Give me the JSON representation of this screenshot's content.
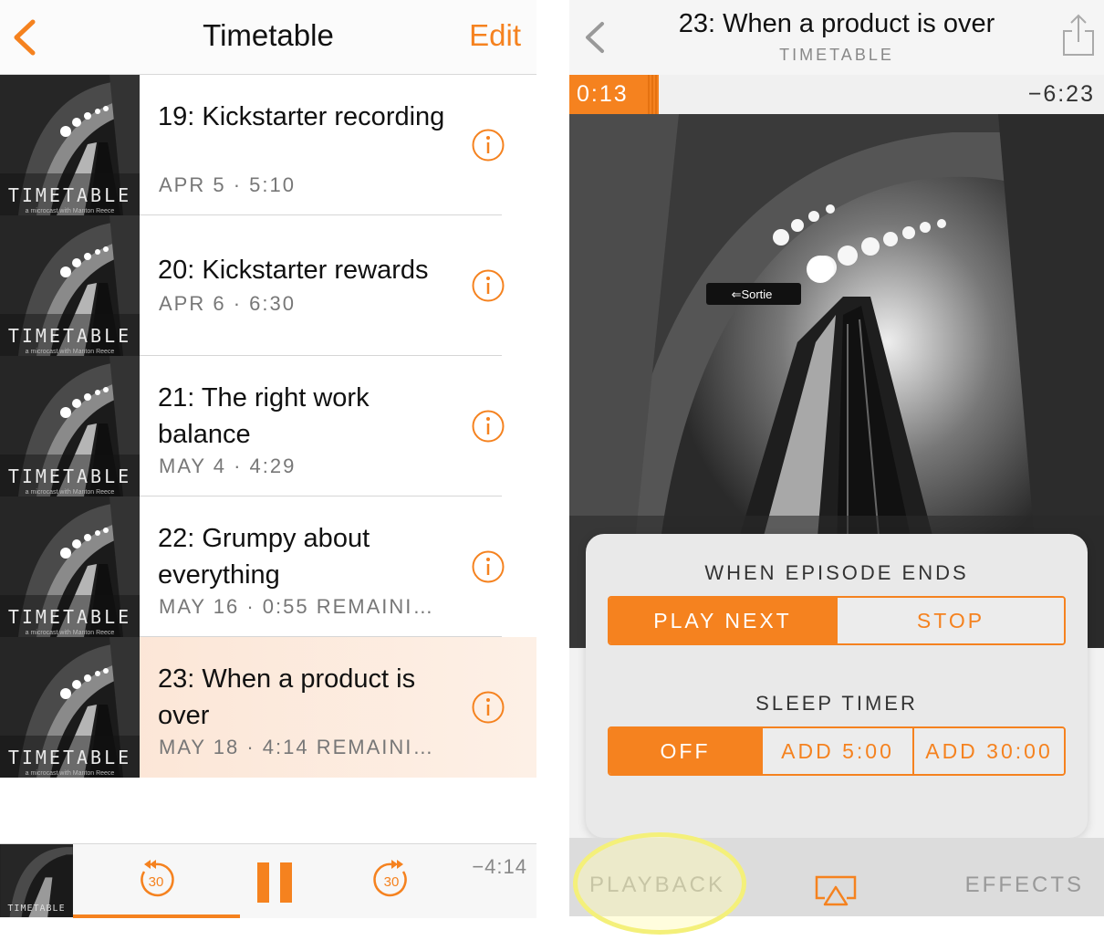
{
  "left": {
    "nav": {
      "back_icon": "chevron-left-icon",
      "title": "Timetable",
      "edit_label": "Edit"
    },
    "artwork": {
      "brand": "TIMETABLE",
      "tagline": "a microcast with Manton Reece"
    },
    "episodes": [
      {
        "title": "19: Kickstarter recording",
        "meta": "APR 5 · 5:10",
        "active": false
      },
      {
        "title": "20: Kickstarter rewards",
        "meta": "APR 6 · 6:30",
        "active": false
      },
      {
        "title": "21: The right work balance",
        "meta": "MAY 4 · 4:29",
        "active": false
      },
      {
        "title": "22: Grumpy about everything",
        "meta": "MAY 16 · 0:55 REMAINI…",
        "active": false
      },
      {
        "title": "23: When a product is over",
        "meta": "MAY 18 · 4:14 REMAINI…",
        "active": true
      }
    ],
    "mini_player": {
      "brand": "TIMETABLE",
      "skip_back_label": "30",
      "skip_forward_label": "30",
      "remaining": "−4:14",
      "progress_fraction": 0.36
    }
  },
  "right": {
    "nav": {
      "title": "23: When a product is over",
      "subtitle": "TIMETABLE",
      "back_icon": "chevron-left-icon",
      "share_icon": "share-icon"
    },
    "scrubber": {
      "elapsed": "0:13",
      "remaining": "−6:23"
    },
    "popover": {
      "episode_ends_label": "WHEN EPISODE ENDS",
      "episode_ends_options": [
        "PLAY NEXT",
        "STOP"
      ],
      "episode_ends_selected": 0,
      "sleep_timer_label": "SLEEP TIMER",
      "sleep_timer_options": [
        "OFF",
        "ADD 5:00",
        "ADD 30:00"
      ],
      "sleep_timer_selected": 0
    },
    "tabbar": {
      "playback_label": "PLAYBACK",
      "airplay_icon": "airplay-icon",
      "effects_label": "EFFECTS"
    }
  },
  "colors": {
    "accent": "#f5821f",
    "highlight": "#f4f07a",
    "active_row": "#fce3d2"
  }
}
